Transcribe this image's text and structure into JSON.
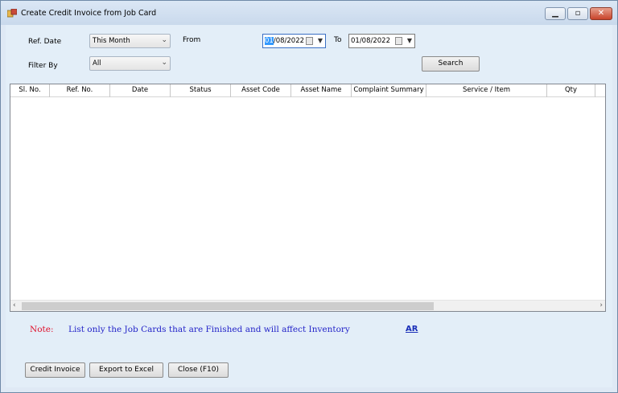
{
  "window": {
    "title": "Create Credit Invoice from Job Card",
    "controls": {
      "minimize": "▭",
      "maximize": "□",
      "close": "✕"
    }
  },
  "filters": {
    "ref_date_label": "Ref. Date",
    "ref_date_value": "This Month",
    "filter_by_label": "Filter By",
    "filter_by_value": "All",
    "from_label": "From",
    "from_date_selected": "01",
    "from_date_rest": "/08/2022",
    "to_label": "To",
    "to_date": "01/08/2022",
    "search_label": "Search"
  },
  "grid": {
    "columns": [
      "Sl. No.",
      "Ref. No.",
      "Date",
      "Status",
      "Asset Code",
      "Asset Name",
      "Complaint Summary",
      "Service / Item",
      "Qty"
    ],
    "rows": []
  },
  "note": {
    "label": "Note:",
    "text": "List only the Job Cards that are Finished and will affect Inventory",
    "link": "AR"
  },
  "footer": {
    "credit_invoice_label": "Credit Invoice",
    "export_label": "Export to Excel",
    "close_label": "Close (F10)"
  },
  "icons": {
    "dropdown": "chevron-down-icon",
    "calendar": "calendar-icon",
    "scroll_left": "‹",
    "scroll_right": "›"
  }
}
